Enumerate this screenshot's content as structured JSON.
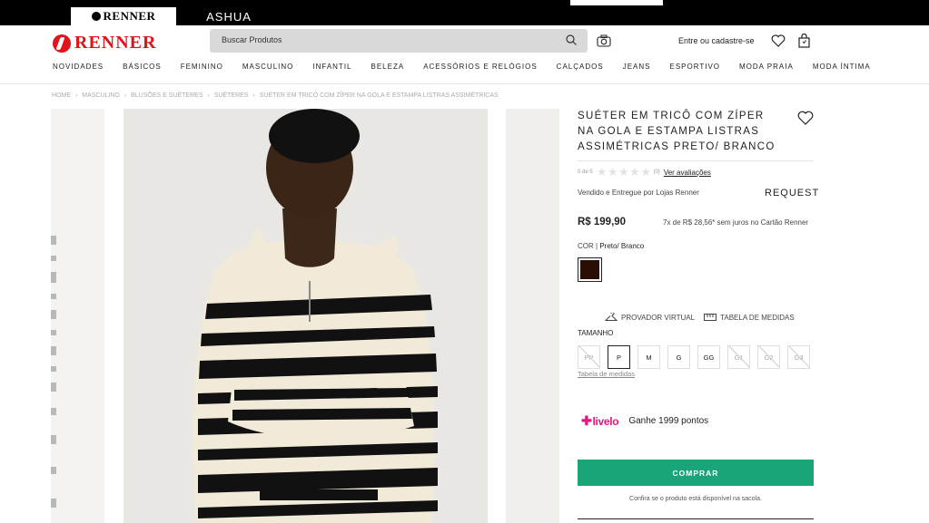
{
  "brands": {
    "renner": "RENNER",
    "ashua": "ASHUA"
  },
  "header": {
    "logo": "RENNER",
    "search_placeholder": "Buscar Produtos",
    "login": "Entre ou cadastre-se"
  },
  "nav": [
    "NOVIDADES",
    "BÁSICOS",
    "FEMININO",
    "MASCULINO",
    "INFANTIL",
    "BELEZA",
    "ACESSÓRIOS E RELÓGIOS",
    "CALÇADOS",
    "JEANS",
    "ESPORTIVO",
    "MODA PRAIA",
    "MODA ÍNTIMA"
  ],
  "breadcrumb": [
    "HOME",
    "›",
    "MASCULINO",
    "›",
    "BLUSÕES E SUÉTERES",
    "›",
    "SUÉTERES",
    "›",
    "SUÉTER EM TRICÔ COM ZÍPER NA GOLA E ESTAMPA LISTRAS ASSIMÉTRICAS"
  ],
  "product": {
    "title": "SUÉTER EM TRICÔ COM ZÍPER NA GOLA E ESTAMPA LISTRAS ASSIMÉTRICAS PRETO/ BRANCO",
    "rating_text": "0 de 5",
    "rating_count": "(0)",
    "rating_link": "Ver avaliações",
    "rating_value": 0,
    "seller": "Vendido e Entregue por Lojas Renner",
    "seller_brand": "REQUEST",
    "price": "R$ 199,90",
    "installments": "7x de R$ 28,56* sem juros no Cartão Renner",
    "color_label": "COR |",
    "color_value": "Preto/ Branco",
    "swatch_color": "#2a0e06",
    "virtual_fitter": "PROVADOR VIRTUAL",
    "size_chart": "TABELA DE MEDIDAS",
    "size_label": "TAMANHO",
    "sizes": [
      {
        "label": "PP",
        "available": false
      },
      {
        "label": "P",
        "available": true,
        "selected": true
      },
      {
        "label": "M",
        "available": true
      },
      {
        "label": "G",
        "available": true
      },
      {
        "label": "GG",
        "available": true
      },
      {
        "label": "G1",
        "available": false
      },
      {
        "label": "G2",
        "available": false
      },
      {
        "label": "G3",
        "available": false
      }
    ],
    "size_table_link": "Tabela de medidas",
    "livelo_brand": "livelo",
    "livelo_points": "Ganhe 1999 pontos",
    "buy_label": "COMPRAR",
    "buy_note": "Confira se o produto está disponível na sacola.",
    "buy_color": "#1aa579"
  }
}
